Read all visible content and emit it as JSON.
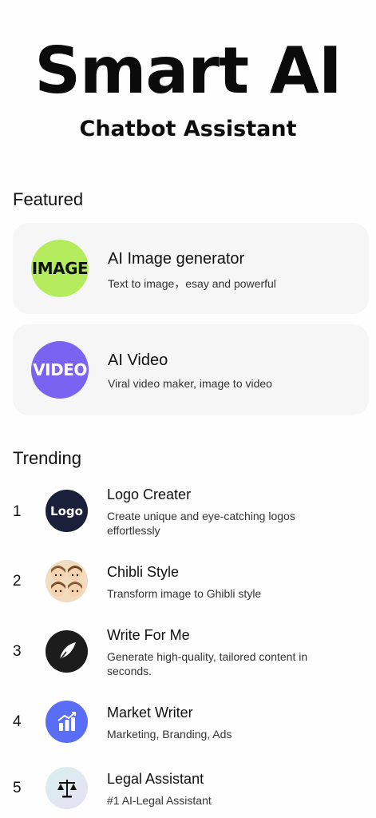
{
  "header": {
    "title": "Smart AI",
    "subtitle": "Chatbot Assistant"
  },
  "featured": {
    "section_title": "Featured",
    "items": [
      {
        "icon_text": "IMAGE",
        "title": "AI Image generator",
        "description": "Text to image，esay and powerful",
        "icon_color": "#b5ec5e"
      },
      {
        "icon_text": "VIDEO",
        "title": "AI Video",
        "description": "Viral video maker,  image to video",
        "icon_color": "#7a63f0"
      }
    ]
  },
  "trending": {
    "section_title": "Trending",
    "items": [
      {
        "rank": "1",
        "icon": "logo-icon",
        "icon_text": "Logo",
        "title": "Logo Creater",
        "description": "Create unique and eye-catching logos effortlessly"
      },
      {
        "rank": "2",
        "icon": "chibli-faces-icon",
        "title": "Chibli Style",
        "description": "Transform image to Ghibli style"
      },
      {
        "rank": "3",
        "icon": "quill-pen-icon",
        "title": "Write For Me",
        "description": "Generate high-quality, tailored content in seconds."
      },
      {
        "rank": "4",
        "icon": "bar-chart-icon",
        "title": "Market Writer",
        "description": "Marketing, Branding, Ads"
      },
      {
        "rank": "5",
        "icon": "scales-icon",
        "title": "Legal Assistant",
        "description": "#1 AI-Legal Assistant"
      }
    ]
  },
  "colors": {
    "card_bg": "#f6f6f6",
    "logo_icon_bg": "#1a1f3a",
    "chart_icon_bg": "#5a6ef5"
  }
}
